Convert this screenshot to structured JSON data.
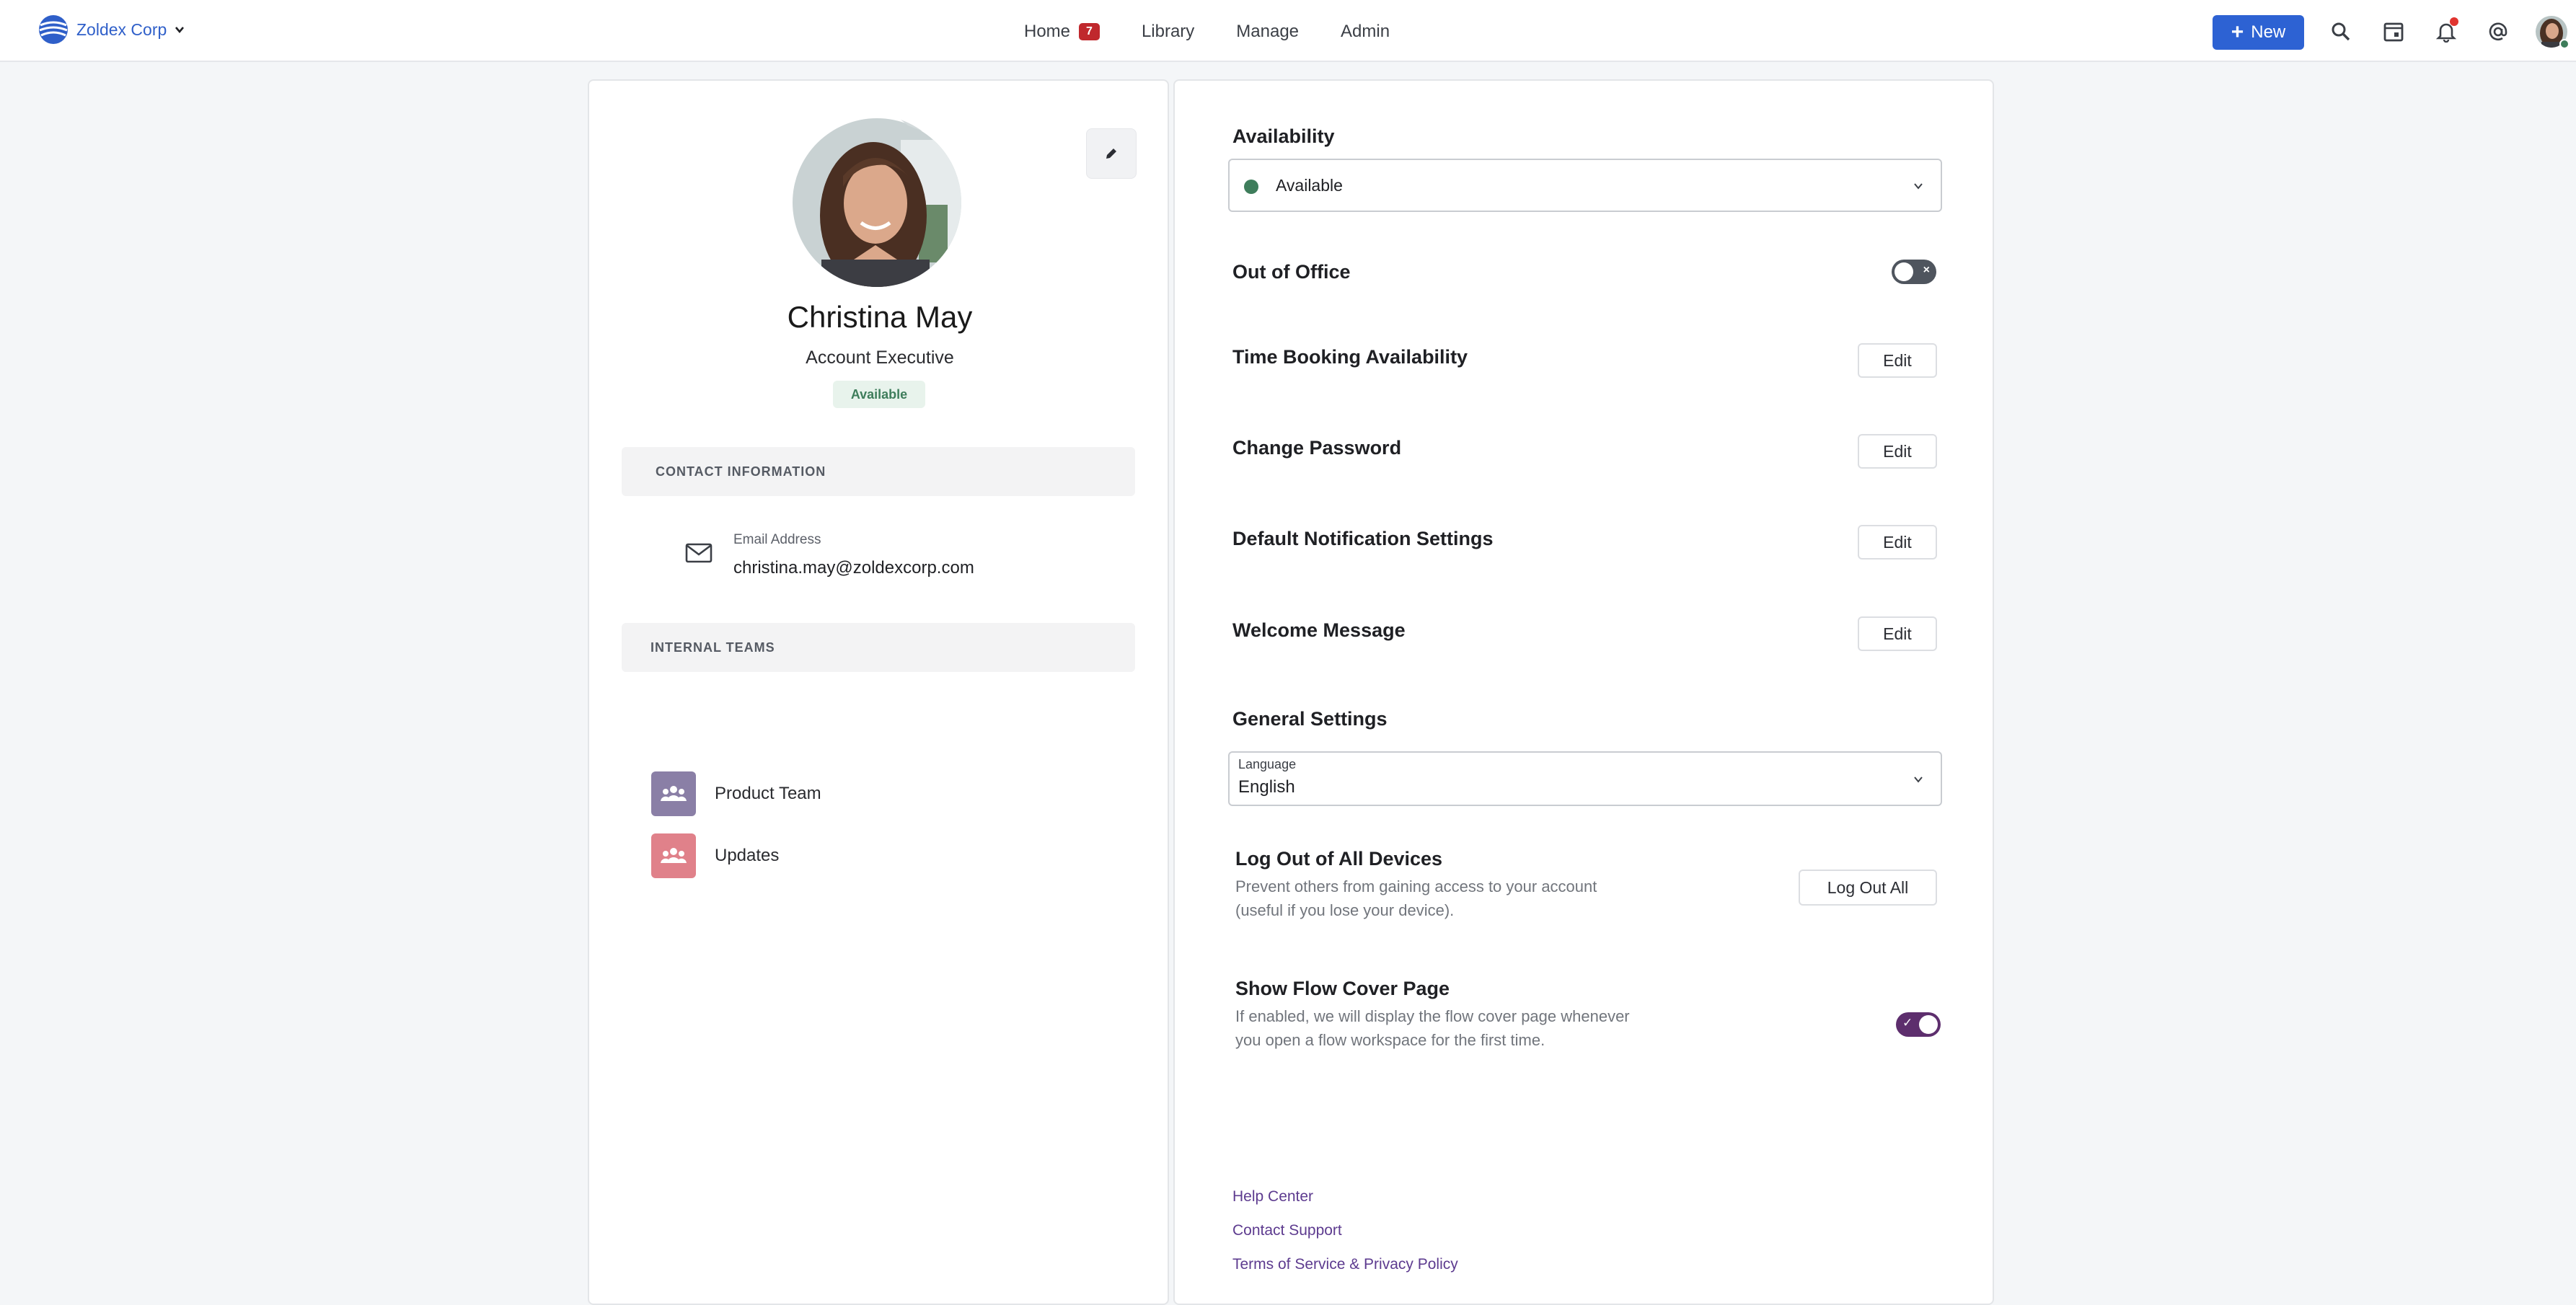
{
  "topbar": {
    "org_name": "Zoldex Corp",
    "nav": [
      {
        "label": "Home",
        "badge": "7"
      },
      {
        "label": "Library"
      },
      {
        "label": "Manage"
      },
      {
        "label": "Admin"
      }
    ],
    "new_label": "New",
    "icons": [
      "search-icon",
      "calendar-icon",
      "bell-icon",
      "at-icon"
    ]
  },
  "profile": {
    "name": "Christina May",
    "title": "Account Executive",
    "status": "Available",
    "contact_heading": "CONTACT INFORMATION",
    "email_label": "Email Address",
    "email": "christina.may@zoldexcorp.com",
    "teams_heading": "INTERNAL TEAMS",
    "teams": [
      {
        "label": "Product Team",
        "color": "#8a7fa6"
      },
      {
        "label": "Updates",
        "color": "#e0818a"
      }
    ]
  },
  "settings": {
    "availability_heading": "Availability",
    "availability_value": "Available",
    "out_of_office_label": "Out of Office",
    "out_of_office_on": false,
    "time_booking_label": "Time Booking Availability",
    "change_password_label": "Change Password",
    "notification_label": "Default Notification Settings",
    "welcome_label": "Welcome Message",
    "edit_label": "Edit",
    "general_heading": "General Settings",
    "language_label": "Language",
    "language_value": "English",
    "logout_title": "Log Out of All Devices",
    "logout_desc": "Prevent others from gaining access to your account (useful if you lose your device).",
    "logout_button": "Log Out All",
    "cover_title": "Show Flow Cover Page",
    "cover_desc": "If enabled, we will display the flow cover page whenever you open a flow workspace for the first time.",
    "cover_on": true
  },
  "footer": {
    "help": "Help Center",
    "support": "Contact Support",
    "terms": "Terms of Service & Privacy Policy"
  },
  "colors": {
    "accent": "#2d62d3",
    "badge": "#c0282d",
    "available": "#3e7d5b",
    "toggle_on": "#5d2e6d",
    "link": "#5d3b8f"
  }
}
